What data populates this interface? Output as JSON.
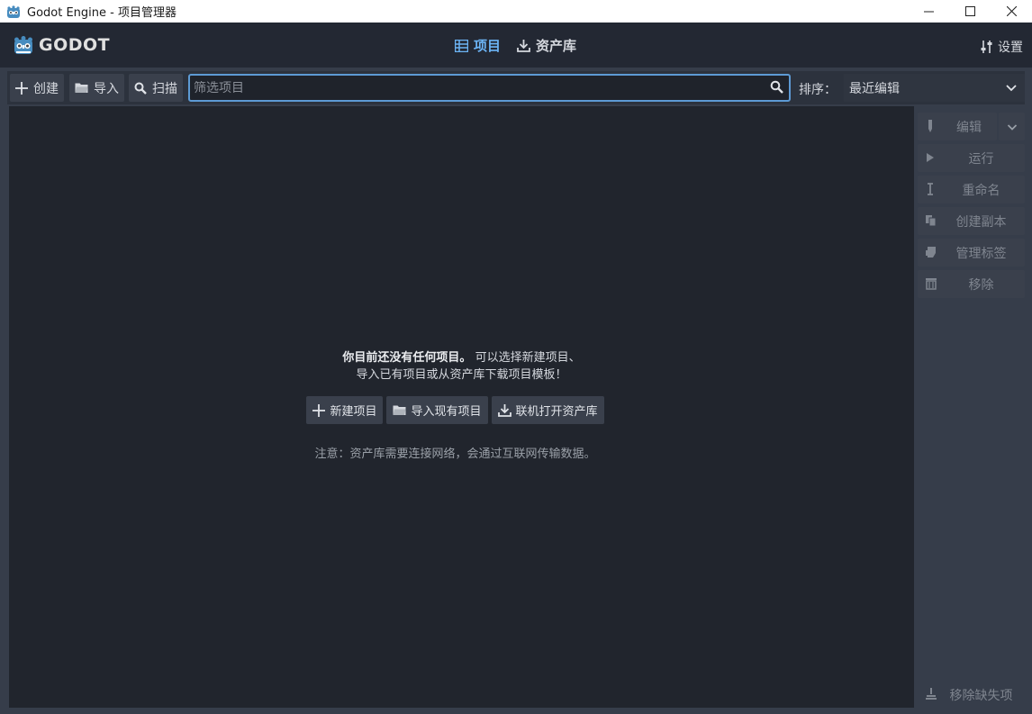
{
  "window": {
    "title": "Godot Engine - 项目管理器",
    "controls": [
      "minimize",
      "maximize",
      "close"
    ]
  },
  "header": {
    "logo_text": "GODOT",
    "tabs": [
      {
        "label": "项目",
        "icon": "project-list-icon",
        "active": true
      },
      {
        "label": "资产库",
        "icon": "download-icon",
        "active": false
      }
    ],
    "settings_label": "设置"
  },
  "toolbar": {
    "create_label": "创建",
    "import_label": "导入",
    "scan_label": "扫描",
    "search_placeholder": "筛选项目",
    "search_value": "",
    "sort_label": "排序：",
    "sort_value": "最近编辑"
  },
  "empty_state": {
    "line1_bold": "你目前还没有任何项目。",
    "line1_rest": " 可以选择新建项目、",
    "line2": "导入已有项目或从资产库下载项目模板！",
    "new_project_label": "新建项目",
    "import_existing_label": "导入现有项目",
    "open_asset_lib_label": "联机打开资产库",
    "note": "注意：资产库需要连接网络，会通过互联网传输数据。"
  },
  "side_panel": {
    "edit_label": "编辑",
    "run_label": "运行",
    "rename_label": "重命名",
    "duplicate_label": "创建副本",
    "tags_label": "管理标签",
    "remove_label": "移除",
    "remove_missing_label": "移除缺失项"
  },
  "colors": {
    "accent": "#6cb4f5",
    "header_bg": "#232833",
    "list_bg": "#21252d",
    "panel_bg": "#363d4a",
    "button_bg": "#3a404c",
    "disabled_text": "#7f858f"
  }
}
